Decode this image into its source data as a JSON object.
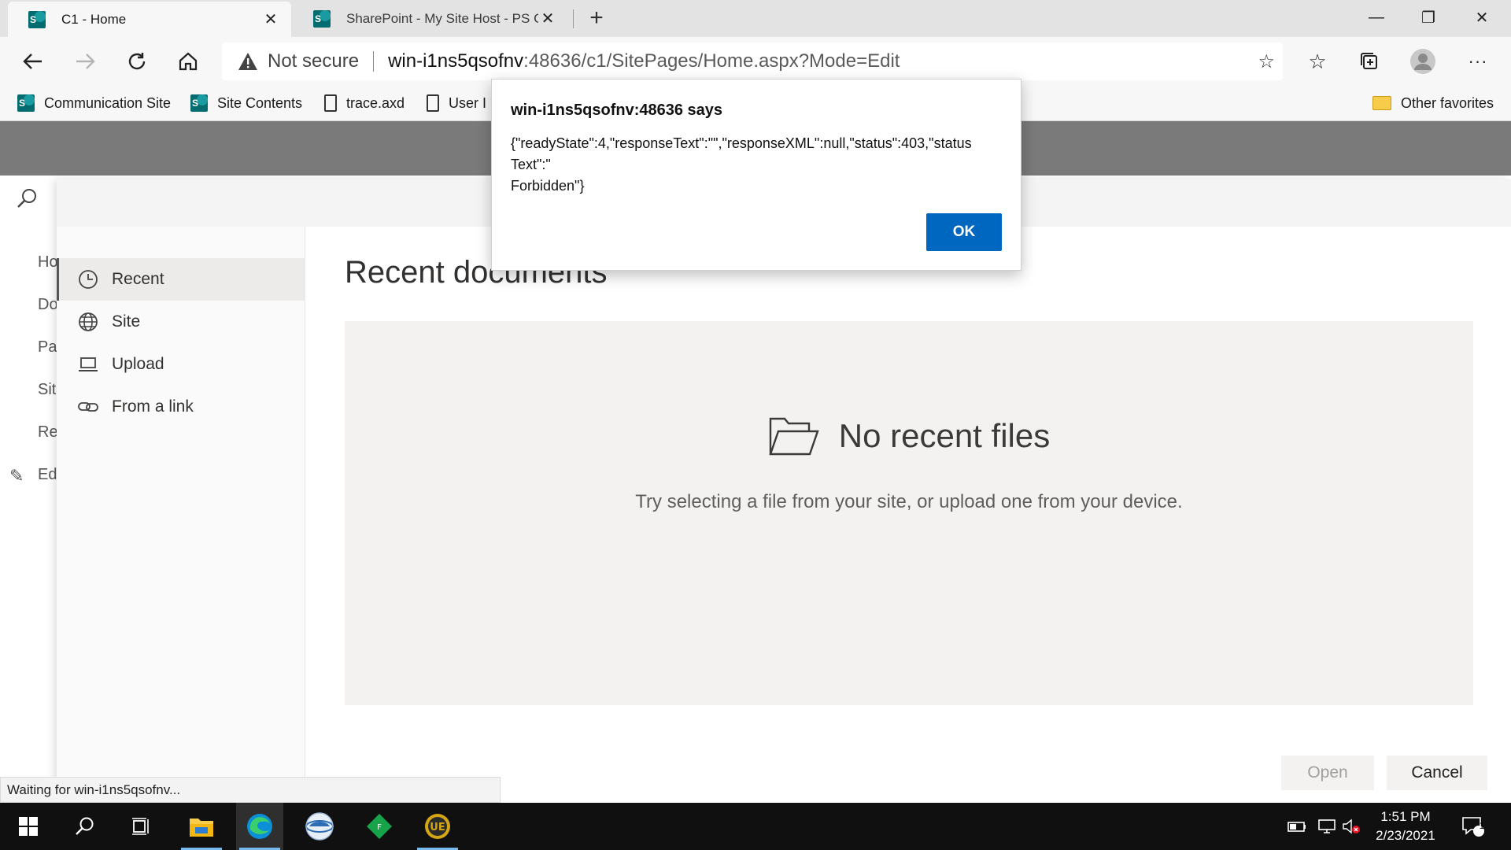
{
  "browser": {
    "tabs": [
      {
        "title": "C1 - Home",
        "active": true
      },
      {
        "title": "SharePoint - My Site Host - PS C",
        "active": false
      }
    ],
    "tab_close_glyph": "✕",
    "new_tab_glyph": "+",
    "window_controls": {
      "minimize": "—",
      "restore": "❐",
      "close": "✕"
    },
    "address": {
      "security_text": "Not secure",
      "host": "win-i1ns5qsofnv",
      "path": ":48636/c1/SitePages/Home.aspx?Mode=Edit"
    },
    "favorites": [
      {
        "label": "Communication Site",
        "icon": "sharepoint-icon"
      },
      {
        "label": "Site Contents",
        "icon": "sharepoint-icon"
      },
      {
        "label": "trace.axd",
        "icon": "file-icon"
      },
      {
        "label": "User I",
        "icon": "file-icon"
      }
    ],
    "other_favorites": "Other favorites",
    "status_text": "Waiting for win-i1ns5qsofnv..."
  },
  "sharepoint": {
    "left_nav": [
      "Ho",
      "Do",
      "Pa",
      "Sit",
      "Re",
      "Ed"
    ],
    "picker_nav": [
      {
        "label": "Recent",
        "icon": "clock-icon",
        "selected": true
      },
      {
        "label": "Site",
        "icon": "globe-icon",
        "selected": false
      },
      {
        "label": "Upload",
        "icon": "laptop-icon",
        "selected": false
      },
      {
        "label": "From a link",
        "icon": "link-icon",
        "selected": false
      }
    ],
    "content_title": "Recent documents",
    "empty_title": "No recent files",
    "empty_subtitle": "Try selecting a file from your site, or upload one from your device.",
    "open_button": "Open",
    "cancel_button": "Cancel"
  },
  "alert": {
    "title": "win-i1ns5qsofnv:48636 says",
    "message_lines": [
      "{\"readyState\":4,\"responseText\":\"\",\"responseXML\":null,\"status\":403,\"status",
      "Text\":\"",
      "Forbidden\"}"
    ],
    "ok_button": "OK"
  },
  "taskbar": {
    "time": "1:51 PM",
    "date": "2/23/2021",
    "notification_count": "1"
  },
  "colors": {
    "accent": "#0067c0",
    "suite_bar": "#7a7a7a",
    "taskbar": "#101010"
  }
}
